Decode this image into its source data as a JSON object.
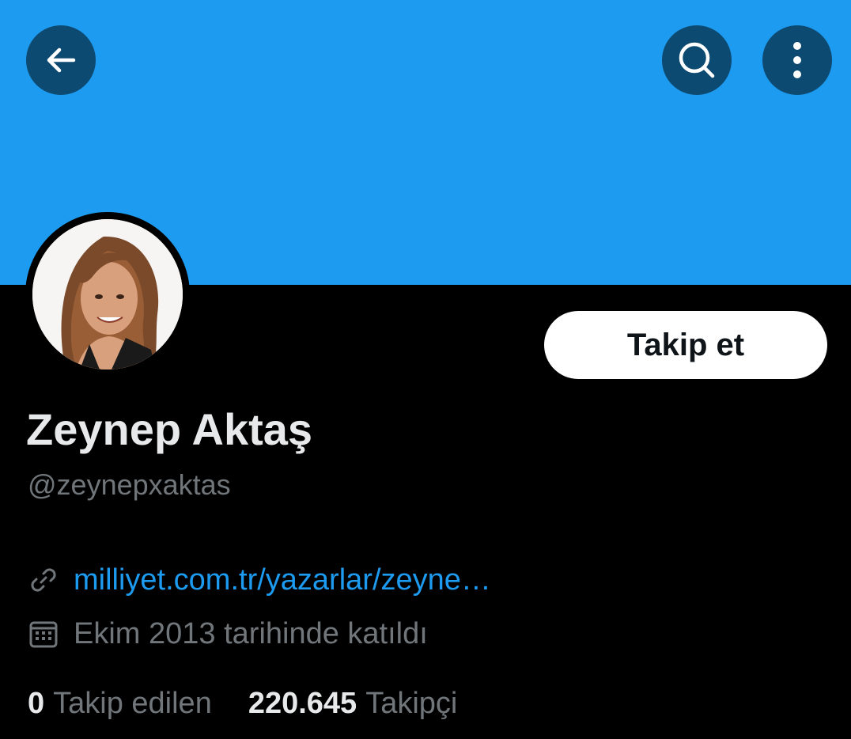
{
  "colors": {
    "banner": "#1d9bf0",
    "background": "#000000",
    "icon_button_bg": "#0d4a72",
    "link": "#1d9bf0",
    "primary_text": "#e7e9ea",
    "secondary_text": "#71767b",
    "follow_button_bg": "#ffffff"
  },
  "header": {
    "back_icon": "arrow-left-icon",
    "search_icon": "search-icon",
    "more_icon": "more-vertical-icon"
  },
  "profile": {
    "follow_label": "Takip et",
    "display_name": "Zeynep Aktaş",
    "handle": "@zeynepxaktas",
    "website": "milliyet.com.tr/yazarlar/zeyne…",
    "joined": "Ekim 2013 tarihinde katıldı"
  },
  "stats": {
    "following_count": "0",
    "following_label": "Takip edilen",
    "followers_count": "220.645",
    "followers_label": "Takipçi"
  }
}
